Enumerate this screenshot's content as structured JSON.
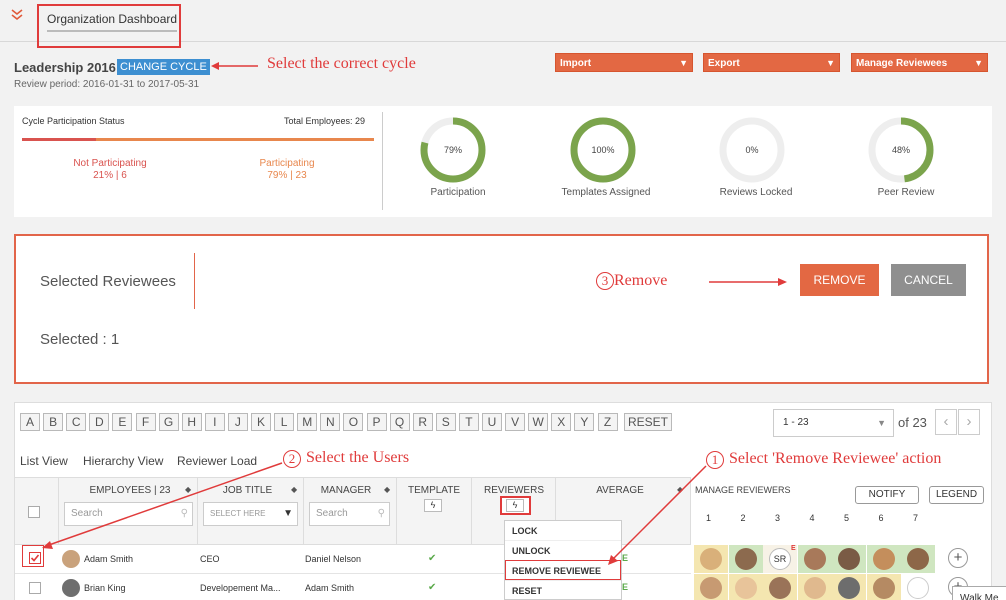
{
  "header": {
    "tab_label": "Organization Dashboard"
  },
  "cycle": {
    "name": "Leadership 2016",
    "change_label": "CHANGE CYCLE",
    "period": "Review period: 2016-01-31 to 2017-05-31"
  },
  "annotations": {
    "select_cycle": "Select the correct cycle",
    "remove_num": "3",
    "remove": "Remove",
    "select_users_num": "2",
    "select_users": "Select the Users",
    "action_num": "1",
    "action": "Select 'Remove Reviewee' action"
  },
  "toolbar": {
    "import": "Import",
    "export": "Export",
    "manage": "Manage Reviewees"
  },
  "participation": {
    "title": "Cycle Participation Status",
    "total": "Total Employees: 29",
    "not_label": "Not Participating",
    "not_value": "21% | 6",
    "part_label": "Participating",
    "part_value": "79% | 23",
    "not_fraction": 0.21
  },
  "donuts": [
    {
      "pct": "79%",
      "label": "Participation",
      "value": 0.79
    },
    {
      "pct": "100%",
      "label": "Templates Assigned",
      "value": 1.0
    },
    {
      "pct": "0%",
      "label": "Reviews Locked",
      "value": 0.0
    },
    {
      "pct": "48%",
      "label": "Peer Review",
      "value": 0.48
    }
  ],
  "selected": {
    "title": "Selected Reviewees",
    "count": "Selected : 1",
    "remove": "REMOVE",
    "cancel": "CANCEL"
  },
  "letters": [
    "A",
    "B",
    "C",
    "D",
    "E",
    "F",
    "G",
    "H",
    "I",
    "J",
    "K",
    "L",
    "M",
    "N",
    "O",
    "P",
    "Q",
    "R",
    "S",
    "T",
    "U",
    "V",
    "W",
    "X",
    "Y",
    "Z"
  ],
  "reset": "RESET",
  "pager": {
    "range": "1 - 23",
    "of": "of 23"
  },
  "views": {
    "list": "List View",
    "hierarchy": "Hierarchy View",
    "load": "Reviewer Load"
  },
  "table": {
    "employees": "EMPLOYEES | 23",
    "job": "JOB TITLE",
    "manager": "MANAGER",
    "template": "TEMPLATE",
    "reviewers": "REVIEWERS",
    "average": "AVERAGE",
    "manage": "MANAGE REVIEWERS",
    "search_placeholder": "Search",
    "select_placeholder": "SELECT HERE",
    "notify": "NOTIFY",
    "legend": "LEGEND",
    "slots": [
      "1",
      "2",
      "3",
      "4",
      "5",
      "6",
      "7"
    ],
    "rows": [
      {
        "name": "Adam Smith",
        "job": "CEO",
        "manager": "Daniel Nelson",
        "checked": true
      },
      {
        "name": "Brian King",
        "job": "Developement Ma...",
        "manager": "Adam Smith",
        "checked": false
      }
    ],
    "initials": "SR",
    "flag_e": "E"
  },
  "menu": [
    "LOCK",
    "UNLOCK",
    "REMOVE REVIEWEE",
    "RESET"
  ],
  "colors": {
    "accent": "#e36843",
    "green": "#7ba44c",
    "blue": "#3d8fd1",
    "annot": "#e03b3b"
  },
  "footer_hint": "Walk Me"
}
